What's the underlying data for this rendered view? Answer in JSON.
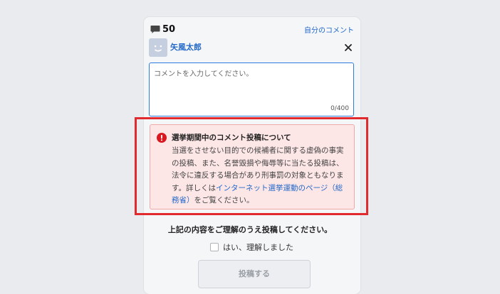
{
  "header": {
    "comment_count": "50",
    "my_comments_link": "自分のコメント"
  },
  "user": {
    "name": "矢風太郎"
  },
  "comment_input": {
    "placeholder": "コメントを入力してください。",
    "counter": "0/400"
  },
  "notice": {
    "title": "選挙期間中のコメント投稿について",
    "body_before_link": "当選をさせない目的での候補者に関する虚偽の事実の投稿、また、名誉毀損や侮辱等に当たる投稿は、法令に違反する場合があり刑事罰の対象ともなります。詳しくは",
    "link_text": "インターネット選挙運動のページ（総務省）",
    "body_after_link": "をご覧ください。"
  },
  "confirm": {
    "instruction": "上記の内容をご理解のうえ投稿してください。",
    "checkbox_label": "はい、理解しました"
  },
  "submit_button": {
    "label": "投稿する"
  },
  "colors": {
    "accent": "#2168c9",
    "highlight_border": "#e22a2e",
    "notice_bg": "#fde6e6",
    "error_icon": "#d71a21"
  },
  "icons": {
    "comment": "speech-bubble-icon",
    "close": "close-icon",
    "error": "exclamation-circle-icon"
  }
}
